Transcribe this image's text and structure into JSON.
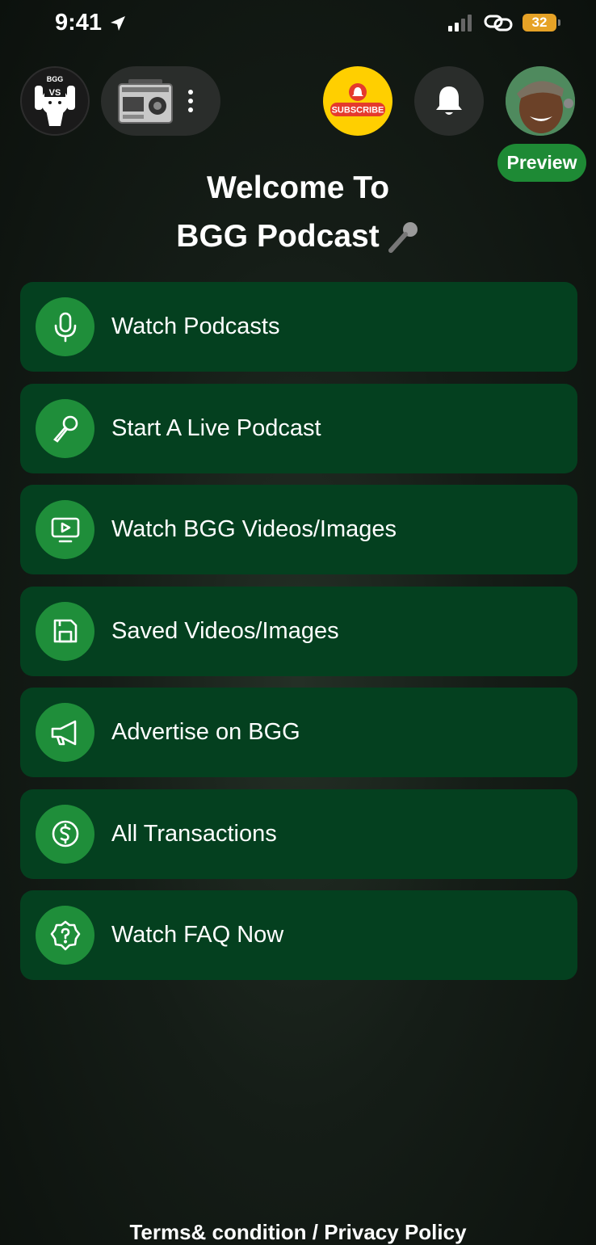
{
  "status_bar": {
    "time": "9:41",
    "battery": "32"
  },
  "header": {
    "logo_text_top": "BGG",
    "logo_text_vs": "VS",
    "subscribe_label": "SUBSCRIBE",
    "preview_label": "Preview"
  },
  "welcome": {
    "line1": "Welcome To",
    "line2": "BGG Podcast"
  },
  "menu": [
    {
      "label": "Watch Podcasts",
      "icon": "microphone-icon"
    },
    {
      "label": "Start A Live Podcast",
      "icon": "handheld-mic-icon"
    },
    {
      "label": "Watch BGG Videos/Images",
      "icon": "video-screen-icon"
    },
    {
      "label": "Saved Videos/Images",
      "icon": "save-icon"
    },
    {
      "label": "Advertise on BGG",
      "icon": "megaphone-icon"
    },
    {
      "label": "All Transactions",
      "icon": "dollar-icon"
    },
    {
      "label": "Watch FAQ Now",
      "icon": "help-badge-icon"
    }
  ],
  "footer": {
    "links_text": "Terms& condition / Privacy Policy"
  },
  "colors": {
    "menu_bg": "#04401f",
    "icon_bg": "#1f8e3a",
    "preview_bg": "#1e8a35",
    "subscribe_bg": "#ffcf00"
  }
}
